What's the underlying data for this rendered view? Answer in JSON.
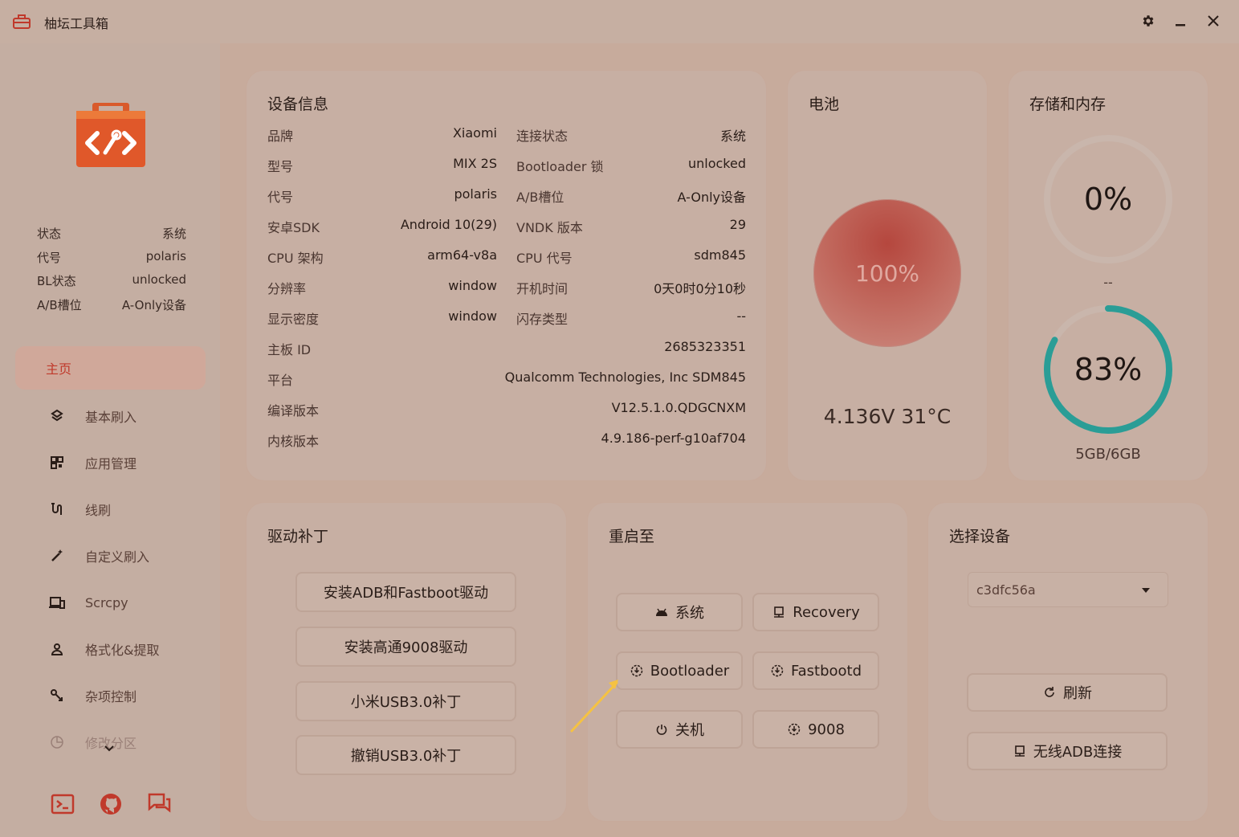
{
  "window": {
    "title": "柚坛工具箱",
    "settings_icon": "gear-icon",
    "minimize_icon": "minimize-icon",
    "close_icon": "close-icon"
  },
  "sidebar": {
    "status": [
      {
        "label": "状态",
        "value": "系统"
      },
      {
        "label": "代号",
        "value": "polaris"
      },
      {
        "label": "BL状态",
        "value": "unlocked"
      },
      {
        "label": "A/B槽位",
        "value": "A-Only设备"
      }
    ],
    "nav": [
      {
        "label": "主页",
        "icon": "home"
      },
      {
        "label": "基本刷入",
        "icon": "flash-icon"
      },
      {
        "label": "应用管理",
        "icon": "apps-icon"
      },
      {
        "label": "线刷",
        "icon": "cable-icon"
      },
      {
        "label": "自定义刷入",
        "icon": "wand-icon"
      },
      {
        "label": "Scrcpy",
        "icon": "devices-icon"
      },
      {
        "label": "格式化&提取",
        "icon": "person-icon"
      },
      {
        "label": "杂项控制",
        "icon": "tools-icon"
      },
      {
        "label": "修改分区",
        "icon": "pie-icon"
      }
    ],
    "bottom_icons": [
      "terminal-icon",
      "github-icon",
      "chat-icon"
    ]
  },
  "device_info": {
    "title": "设备信息",
    "left": [
      {
        "k": "品牌",
        "v": "Xiaomi"
      },
      {
        "k": "型号",
        "v": "MIX 2S"
      },
      {
        "k": "代号",
        "v": "polaris"
      },
      {
        "k": "安卓SDK",
        "v": "Android 10(29)"
      },
      {
        "k": "CPU 架构",
        "v": "arm64-v8a"
      },
      {
        "k": "分辨率",
        "v": "window"
      },
      {
        "k": "显示密度",
        "v": "window"
      }
    ],
    "right": [
      {
        "k": "连接状态",
        "v": "系统"
      },
      {
        "k": "Bootloader 锁",
        "v": "unlocked"
      },
      {
        "k": "A/B槽位",
        "v": "A-Only设备"
      },
      {
        "k": "VNDK 版本",
        "v": "29"
      },
      {
        "k": "CPU 代号",
        "v": "sdm845"
      },
      {
        "k": "开机时间",
        "v": "0天0时0分10秒"
      },
      {
        "k": "闪存类型",
        "v": "--"
      }
    ],
    "full": [
      {
        "k": "主板 ID",
        "v": "2685323351"
      },
      {
        "k": "平台",
        "v": "Qualcomm Technologies, Inc SDM845"
      },
      {
        "k": "编译版本",
        "v": "V12.5.1.0.QDGCNXM"
      },
      {
        "k": "内核版本",
        "v": "4.9.186-perf-g10af704"
      }
    ]
  },
  "battery": {
    "title": "电池",
    "percent_label": "100%",
    "info": "4.136V 31°C",
    "level": 1.0
  },
  "storage": {
    "title": "存储和内存",
    "storage_percent": "0%",
    "storage_detail": "--",
    "memory_percent": "83%",
    "memory_detail": "5GB/6GB",
    "storage_level": 0.0,
    "memory_level": 0.83,
    "ring_color": "#2a9d96",
    "ring_track": "#c9b6ac"
  },
  "driver": {
    "title": "驱动补丁",
    "buttons": [
      "安装ADB和Fastboot驱动",
      "安装高通9008驱动",
      "小米USB3.0补丁",
      "撤销USB3.0补丁"
    ]
  },
  "reboot": {
    "title": "重启至",
    "buttons": [
      {
        "label": "系统",
        "icon": "android-icon"
      },
      {
        "label": "Recovery",
        "icon": "monitor-icon"
      },
      {
        "label": "Bootloader",
        "icon": "download-circle-icon"
      },
      {
        "label": "Fastbootd",
        "icon": "download-circle-icon"
      },
      {
        "label": "关机",
        "icon": "power-icon"
      },
      {
        "label": "9008",
        "icon": "download-circle-icon"
      }
    ]
  },
  "device_select": {
    "title": "选择设备",
    "selected": "c3dfc56a",
    "refresh_label": "刷新",
    "wireless_label": "无线ADB连接"
  },
  "colors": {
    "accent": "#c0392b",
    "arrow": "#f5c242"
  }
}
